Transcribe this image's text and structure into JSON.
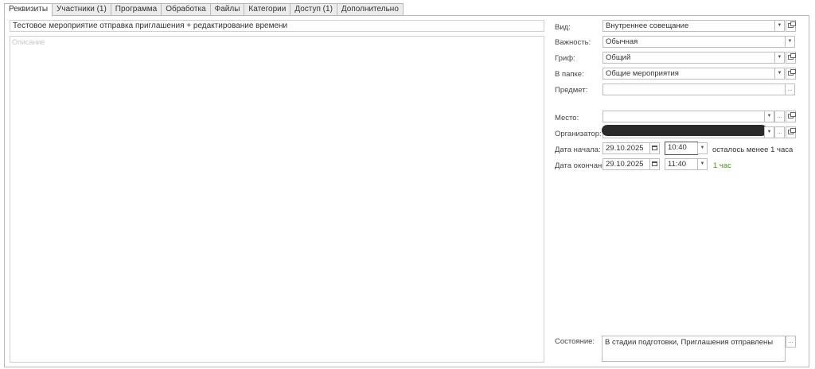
{
  "tabs": [
    {
      "label": "Реквизиты",
      "active": true
    },
    {
      "label": "Участники (1)",
      "active": false
    },
    {
      "label": "Программа",
      "active": false
    },
    {
      "label": "Обработка",
      "active": false
    },
    {
      "label": "Файлы",
      "active": false
    },
    {
      "label": "Категории",
      "active": false
    },
    {
      "label": "Доступ (1)",
      "active": false
    },
    {
      "label": "Дополнительно",
      "active": false
    }
  ],
  "subject": "Тестовое мероприятие отправка приглашения + редактирование времени",
  "description": {
    "placeholder": "Описание",
    "value": ""
  },
  "fields": {
    "vid": {
      "label": "Вид:",
      "value": "Внутреннее совещание"
    },
    "importance": {
      "label": "Важность:",
      "value": "Обычная"
    },
    "grif": {
      "label": "Гриф:",
      "value": "Общий"
    },
    "folder": {
      "label": "В папке:",
      "value": "Общие мероприятия"
    },
    "predmet": {
      "label": "Предмет:",
      "value": ""
    },
    "place": {
      "label": "Место:",
      "value": ""
    },
    "organizer": {
      "label": "Организатор:",
      "value": ""
    },
    "start": {
      "label": "Дата начала:",
      "date": "29.10.2025",
      "time": "10:40",
      "note": "осталось менее 1 часа"
    },
    "end": {
      "label": "Дата окончания:",
      "date": "29.10.2025",
      "time": "11:40",
      "note": "1 час"
    },
    "state": {
      "label": "Состояние:",
      "value": "В стадии подготовки, Приглашения отправлены"
    }
  },
  "icons": {
    "dropdown": "▼",
    "more": "...",
    "open": "open-icon",
    "calendar": "calendar-icon"
  },
  "colors": {
    "duration_note": "#4b8a2f"
  }
}
